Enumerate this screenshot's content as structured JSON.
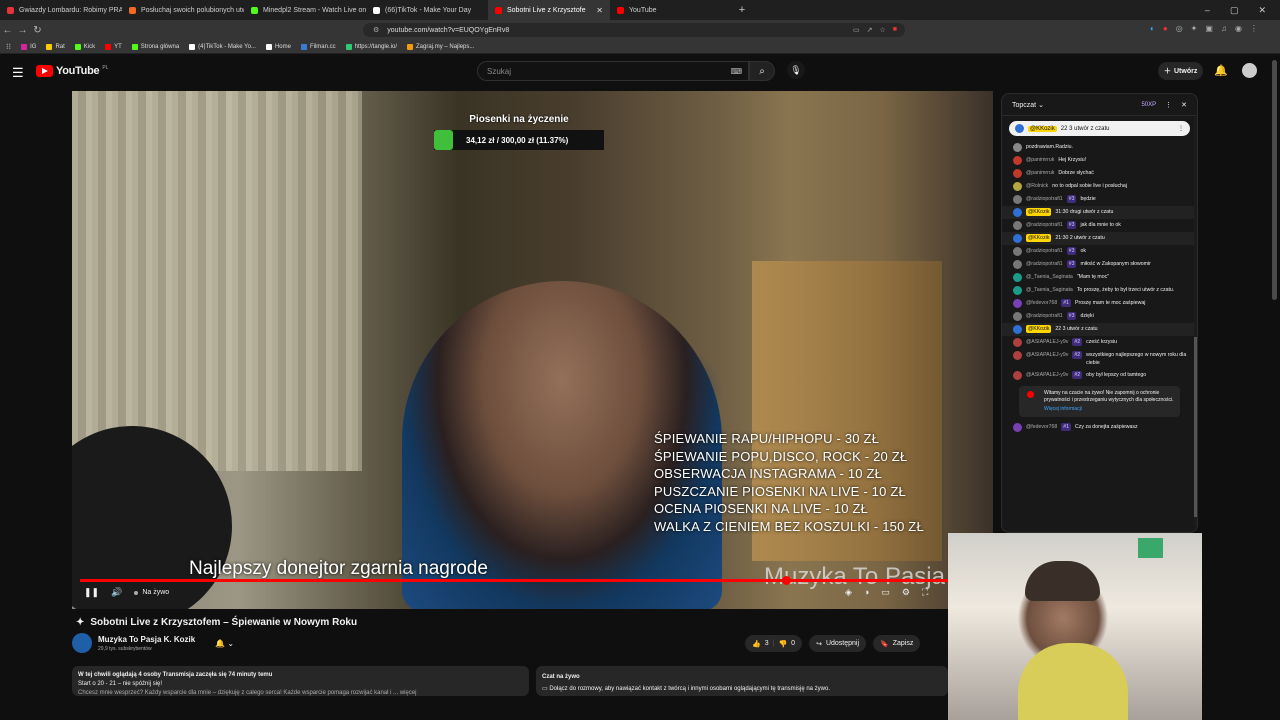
{
  "browser": {
    "tabs": [
      {
        "title": "Gwiazdy Lombardu: Robimy PRAWO",
        "color": "#e5323b",
        "active": false
      },
      {
        "title": "Posłuchaj swoich polubionych utwo",
        "color": "#f26a22",
        "active": false
      },
      {
        "title": "Minedpl2 Stream - Watch Live on Ki",
        "color": "#53fc18",
        "active": false
      },
      {
        "title": "(66)TikTok - Make Your Day",
        "color": "#ffffff",
        "active": false
      },
      {
        "title": "Sobotni Live z Krzysztofe",
        "color": "#ff0000",
        "active": true
      },
      {
        "title": "YouTube",
        "color": "#ff0000",
        "active": false
      }
    ],
    "url": "youtube.com/watch?v=EUQOYgEnRv8",
    "bookmarks": [
      {
        "label": "IG",
        "color": "#d6249f"
      },
      {
        "label": "Rat",
        "color": "#ffcc00"
      },
      {
        "label": "Kick",
        "color": "#53fc18"
      },
      {
        "label": "YT",
        "color": "#ff0000"
      },
      {
        "label": "Strona główna",
        "color": "#53fc18"
      },
      {
        "label": "(4)TikTok - Make Yo...",
        "color": "#ffffff"
      },
      {
        "label": "Home",
        "color": "#ffffff"
      },
      {
        "label": "Filman.cc",
        "color": "#3a7bd5"
      },
      {
        "label": "https://tangle.io/",
        "color": "#2ecc71"
      },
      {
        "label": "Zagraj.my – Najleps...",
        "color": "#f39c12"
      }
    ]
  },
  "youtube": {
    "logo": "YouTube",
    "region": "PL",
    "search_placeholder": "Szukaj",
    "create_label": "Utwórz"
  },
  "video": {
    "goal_title": "Piosenki na życzenie",
    "goal_progress": "34,12 zł / 300,00 zł (11.37%)",
    "goal_fraction": 0.1137,
    "price_list": [
      "ŚPIEWANIE RAPU/HIPHOPU - 30 ZŁ",
      "ŚPIEWANIE POPU,DISCO, ROCK - 20 ZŁ",
      "OBSERWACJA INSTAGRAMA - 10 ZŁ",
      "PUSZCZANIE PIOSENKI NA LIVE - 10 ZŁ",
      "OCENA PIOSENKI NA LIVE - 10 ZŁ",
      "WALKA Z CIENIEM BEZ KOSZULKI - 150 ZŁ"
    ],
    "overlay_text": "Najlepszy donejtor zgarnia nagrode",
    "overlay_name": "Muzyka To Pasja",
    "live_label": "Na żywo"
  },
  "info": {
    "title": "Sobotni Live z Krzysztofem – Śpiewanie w Nowym Roku",
    "channel_name": "Muzyka To Pasja K. Kozik",
    "subscribers": "29,9 tys. subskrybentów",
    "likes": "3",
    "dislikes": "0",
    "share_label": "Udostępnij",
    "save_label": "Zapisz",
    "desc_line1_bold": "W tej chwili oglądają 4 osoby  Transmisja zaczęła się 74 minuty temu",
    "desc_line2": "Start o 20 - 21 – nie spóźnij się!",
    "desc_line3": "Chcesz mnie wesprzeć? Każdy wsparcie dla mnie – dziękuję z całego serca! Każde wsparcie pomaga rozwijać kanał i ... więcej",
    "chat_title": "Czat na żywo",
    "chat_info": "Dołącz do rozmowy, aby nawiązać kontakt z twórcą i innymi osobami oglądającymi tę transmisję na żywo."
  },
  "chat": {
    "header": "Topczat",
    "xp": "50XP",
    "pinned_author": "@KKozik",
    "pinned_text": "22 3 utwór z czatu",
    "messages": [
      {
        "author": "",
        "badge": "",
        "text": "pozdrawiam.Radziu.",
        "color": "#888",
        "owner": false,
        "hl": false
      },
      {
        "author": "@panimrruk",
        "badge": "",
        "text": "Hej Krzysiu!",
        "color": "#c0392b",
        "owner": false,
        "hl": false
      },
      {
        "author": "@panimrruk",
        "badge": "",
        "text": "Dobrze słychać",
        "color": "#c0392b",
        "owner": false,
        "hl": false
      },
      {
        "author": "@Rolnick",
        "badge": "",
        "text": "no to odpal sobie live i posłuchaj",
        "color": "#b5a642",
        "owner": false,
        "hl": false
      },
      {
        "author": "@radziopotrafi1",
        "badge": "#3",
        "text": "będzie",
        "color": "#777",
        "owner": false,
        "hl": false
      },
      {
        "author": "@KKozik",
        "badge": "",
        "text": "31:30 drugi utwór z czatu",
        "color": "#2f6fd6",
        "owner": true,
        "hl": true
      },
      {
        "author": "@radziopotrafi1",
        "badge": "#3",
        "text": "jak dla mnie to ok",
        "color": "#777",
        "owner": false,
        "hl": false
      },
      {
        "author": "@KKozik",
        "badge": "",
        "text": "21:30 2 utwór z czatu",
        "color": "#2f6fd6",
        "owner": true,
        "hl": true
      },
      {
        "author": "@radziopotrafi1",
        "badge": "#3",
        "text": "ok",
        "color": "#777",
        "owner": false,
        "hl": false
      },
      {
        "author": "@radziopotrafi1",
        "badge": "#3",
        "text": "miłość w Zakopanym słowomir",
        "color": "#777",
        "owner": false,
        "hl": false
      },
      {
        "author": "@_Taenia_Saginata",
        "badge": "",
        "text": "\"Mam tę moc\"",
        "color": "#1a9c8a",
        "owner": false,
        "hl": false
      },
      {
        "author": "@_Taenia_Saginata",
        "badge": "",
        "text": "To proszę, żeby to był trzeci utwór z czatu.",
        "color": "#1a9c8a",
        "owner": false,
        "hl": false
      },
      {
        "author": "@fedevor768",
        "badge": "#1",
        "text": "Proszę mam te moc zaśpiewaj",
        "color": "#7b3fb5",
        "owner": false,
        "hl": false
      },
      {
        "author": "@radziopotrafi1",
        "badge": "#3",
        "text": "dzięki",
        "color": "#777",
        "owner": false,
        "hl": false
      },
      {
        "author": "@KKozik",
        "badge": "",
        "text": "22 3 utwór z czatu",
        "color": "#2f6fd6",
        "owner": true,
        "hl": true
      },
      {
        "author": "@ASIAPALEJ-y9v",
        "badge": "#2",
        "text": "cześć krzysiu",
        "color": "#b04040",
        "owner": false,
        "hl": false
      },
      {
        "author": "@ASIAPALEJ-y9v",
        "badge": "#2",
        "text": "wszystkiego najlepszego w nowym roku dla ciebie",
        "color": "#b04040",
        "owner": false,
        "hl": false
      },
      {
        "author": "@ASIAPALEJ-y9v",
        "badge": "#2",
        "text": "oby był lepszy od tamtego",
        "color": "#b04040",
        "owner": false,
        "hl": false
      }
    ],
    "welcome_text": "Witamy na czacie na żywo! Nie zapomnij o ochronie prywatności i przestrzeganiu wytycznych dla społeczności.",
    "welcome_link": "Więcej informacji",
    "last_author": "@fedevor768",
    "last_badge": "#1",
    "last_text": "Czy za donejta zaśpiewasz"
  }
}
